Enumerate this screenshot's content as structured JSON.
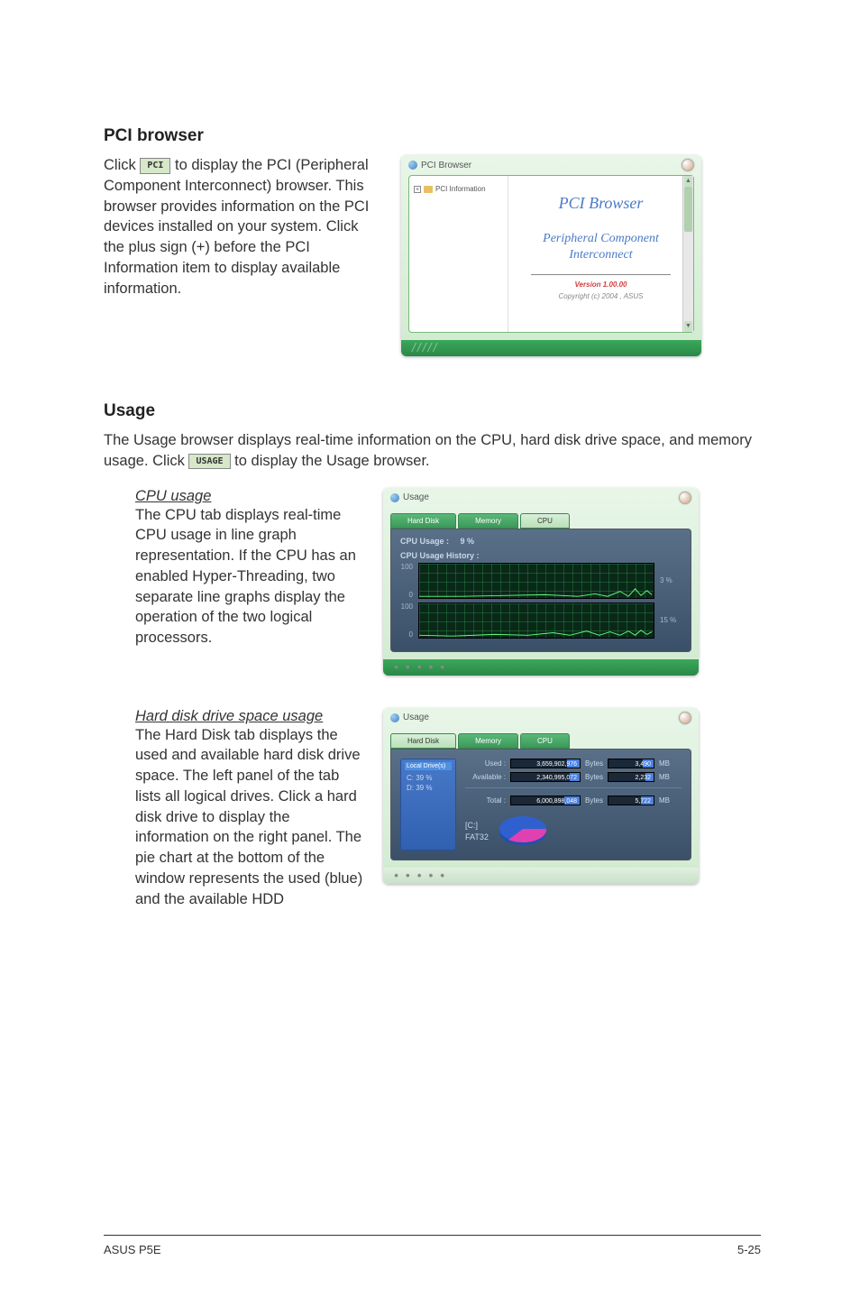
{
  "sections": {
    "pci": {
      "heading": "PCI browser",
      "body_pre": "Click ",
      "icon_label": "PCI",
      "body_post": " to display the PCI (Peripheral Component Interconnect) browser. This browser provides information on the PCI devices installed on your system. Click the plus sign (+) before the PCI Information item to display available information."
    },
    "usage": {
      "heading": "Usage",
      "intro_pre": "The Usage browser displays real-time information on the CPU, hard disk drive space, and memory usage. Click ",
      "icon_label": "USAGE",
      "intro_post": " to display the Usage browser.",
      "cpu": {
        "title": "CPU usage",
        "body": "The CPU tab displays real-time CPU usage in line graph representation. If the CPU has an enabled Hyper-Threading, two separate line graphs display the operation of the two logical processors."
      },
      "hdd": {
        "title": "Hard disk drive space usage",
        "body": "The Hard Disk tab displays the used and available hard disk drive space. The left panel of the tab lists all logical drives. Click a hard disk drive to display the information on the right panel. The pie chart at the bottom of the window represents the used (blue) and the available HDD"
      }
    }
  },
  "pci_window": {
    "title": "PCI Browser",
    "tree_item": "PCI Information",
    "main_title": "PCI Browser",
    "main_sub": "Peripheral Component Interconnect",
    "version": "Version 1.00.00",
    "copyright": "Copyright (c) 2004 , ASUS"
  },
  "usage_cpu_window": {
    "title": "Usage",
    "tabs": [
      "Hard Disk",
      "Memory",
      "CPU"
    ],
    "cpu_usage_label": "CPU Usage :",
    "cpu_usage_value": "9  %",
    "history_label": "CPU Usage History :",
    "ytop": "100",
    "ybottom": "0",
    "pct1": "3 %",
    "pct2": "15 %"
  },
  "usage_hdd_window": {
    "title": "Usage",
    "tabs": [
      "Hard Disk",
      "Memory",
      "CPU"
    ],
    "drives_title": "Local Drive(s)",
    "drives": [
      "C: 39 %",
      "D: 39 %"
    ],
    "rows": {
      "used": {
        "label": "Used :",
        "bytes": "3,659,902,976",
        "bytes_unit": "Bytes",
        "mb": "3,490",
        "mb_unit": "MB"
      },
      "available": {
        "label": "Available :",
        "bytes": "2,340,995,072",
        "bytes_unit": "Bytes",
        "mb": "2,232",
        "mb_unit": "MB"
      },
      "total": {
        "label": "Total :",
        "bytes": "6,000,898,048",
        "bytes_unit": "Bytes",
        "mb": "5,722",
        "mb_unit": "MB"
      }
    },
    "drive_name": "[C:]",
    "fs_type": "FAT32"
  },
  "chart_data": {
    "type": "pie",
    "title": "[C:] FAT32",
    "values": [
      3490,
      2232
    ],
    "labels": [
      "Used",
      "Available"
    ],
    "colors": [
      "#3060d0",
      "#e040b0"
    ]
  },
  "footer": {
    "left": "ASUS P5E",
    "right": "5-25"
  }
}
